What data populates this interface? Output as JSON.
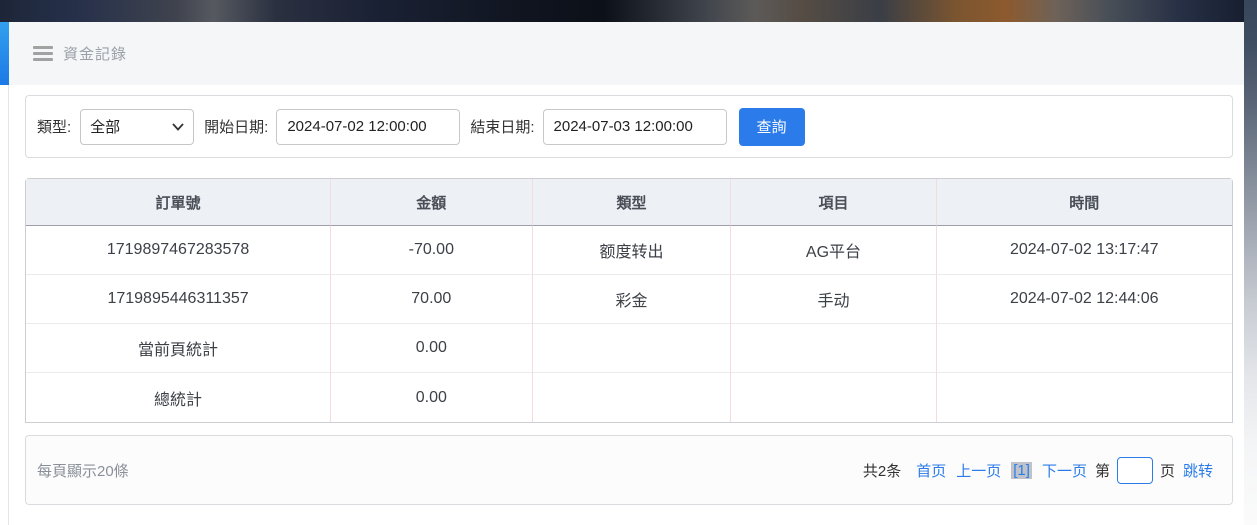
{
  "header": {
    "title": "資金記錄"
  },
  "filters": {
    "type_label": "類型:",
    "type_value": "全部",
    "start_label": "開始日期:",
    "start_value": "2024-07-02 12:00:00",
    "end_label": "結束日期:",
    "end_value": "2024-07-03 12:00:00",
    "search_button": "查詢"
  },
  "table": {
    "columns": [
      "訂單號",
      "金額",
      "類型",
      "項目",
      "時間"
    ],
    "rows": [
      [
        "1719897467283578",
        "-70.00",
        "额度转出",
        "AG平台",
        "2024-07-02 13:17:47"
      ],
      [
        "1719895446311357",
        "70.00",
        "彩金",
        "手动",
        "2024-07-02 12:44:06"
      ],
      [
        "當前頁統計",
        "0.00",
        "",
        "",
        ""
      ],
      [
        "總統計",
        "0.00",
        "",
        "",
        ""
      ]
    ]
  },
  "pagination": {
    "page_size_text": "每頁顯示20條",
    "total_text": "共2条",
    "first_link": "首页",
    "prev_link": "上一页",
    "current_page": "[1]",
    "next_link": "下一页",
    "goto_prefix": "第",
    "goto_value": "",
    "goto_suffix": "页",
    "jump_link": "跳转"
  },
  "colors": {
    "accent_blue": "#2b7cea",
    "active_sidebar_blue": "#2196ed",
    "table_divider_pink": "#f3dcdc"
  }
}
